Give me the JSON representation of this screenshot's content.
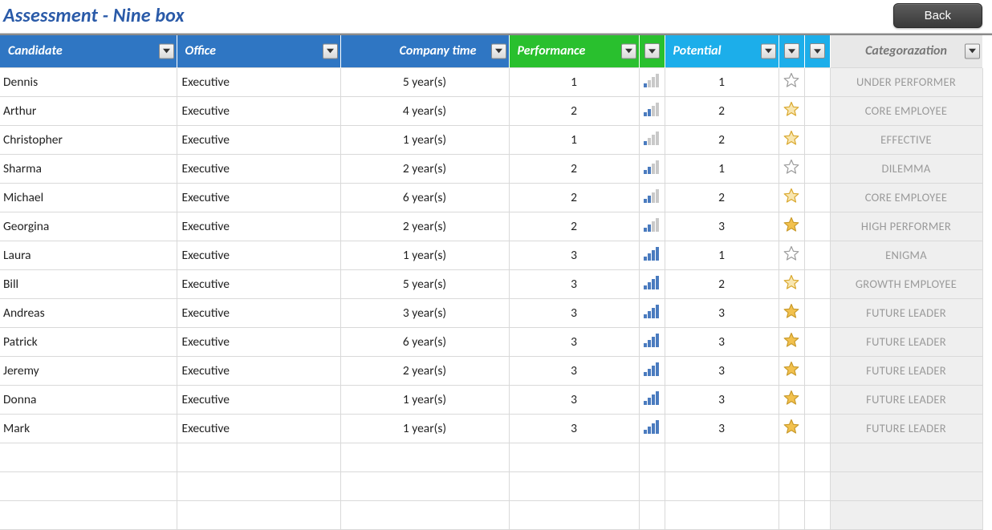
{
  "header": {
    "title": "Assessment - Nine box",
    "back_label": "Back"
  },
  "columns": {
    "candidate": "Candidate",
    "office": "Office",
    "company_time": "Company time",
    "performance": "Performance",
    "potential": "Potential",
    "categorization": "Categorazation"
  },
  "rows": [
    {
      "candidate": "Dennis",
      "office": "Executive",
      "company_time": "5 year(s)",
      "performance": 1,
      "potential": 1,
      "categorization": "UNDER PERFORMER"
    },
    {
      "candidate": "Arthur",
      "office": "Executive",
      "company_time": "4 year(s)",
      "performance": 2,
      "potential": 2,
      "categorization": "CORE EMPLOYEE"
    },
    {
      "candidate": "Christopher",
      "office": "Executive",
      "company_time": "1 year(s)",
      "performance": 1,
      "potential": 2,
      "categorization": "EFFECTIVE"
    },
    {
      "candidate": "Sharma",
      "office": "Executive",
      "company_time": "2 year(s)",
      "performance": 2,
      "potential": 1,
      "categorization": "DILEMMA"
    },
    {
      "candidate": "Michael",
      "office": "Executive",
      "company_time": "6 year(s)",
      "performance": 2,
      "potential": 2,
      "categorization": "CORE EMPLOYEE"
    },
    {
      "candidate": "Georgina",
      "office": "Executive",
      "company_time": "2 year(s)",
      "performance": 2,
      "potential": 3,
      "categorization": "HIGH PERFORMER"
    },
    {
      "candidate": "Laura",
      "office": "Executive",
      "company_time": "1 year(s)",
      "performance": 3,
      "potential": 1,
      "categorization": "ENIGMA"
    },
    {
      "candidate": "Bill",
      "office": "Executive",
      "company_time": "5 year(s)",
      "performance": 3,
      "potential": 2,
      "categorization": "GROWTH EMPLOYEE"
    },
    {
      "candidate": "Andreas",
      "office": "Executive",
      "company_time": "3 year(s)",
      "performance": 3,
      "potential": 3,
      "categorization": "FUTURE LEADER"
    },
    {
      "candidate": "Patrick",
      "office": "Executive",
      "company_time": "6 year(s)",
      "performance": 3,
      "potential": 3,
      "categorization": "FUTURE LEADER"
    },
    {
      "candidate": "Jeremy",
      "office": "Executive",
      "company_time": "2 year(s)",
      "performance": 3,
      "potential": 3,
      "categorization": "FUTURE LEADER"
    },
    {
      "candidate": "Donna",
      "office": "Executive",
      "company_time": "1 year(s)",
      "performance": 3,
      "potential": 3,
      "categorization": "FUTURE LEADER"
    },
    {
      "candidate": "Mark",
      "office": "Executive",
      "company_time": "1 year(s)",
      "performance": 3,
      "potential": 3,
      "categorization": "FUTURE LEADER"
    }
  ],
  "empty_rows": 3
}
